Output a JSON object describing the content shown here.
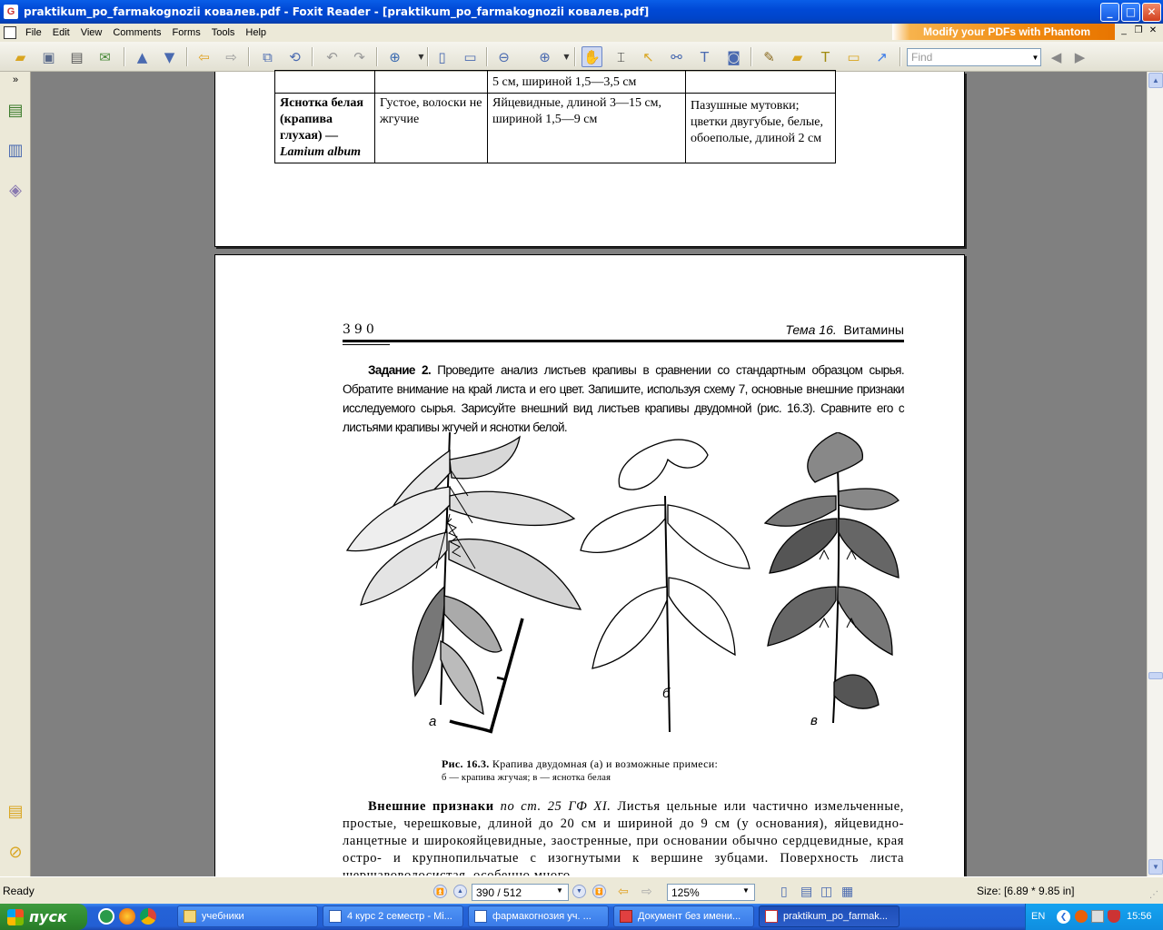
{
  "window": {
    "title": "praktikum_po_farmakognozii ковалев.pdf - Foxit Reader - [praktikum_po_farmakognozii ковалев.pdf]",
    "title_icon": "G",
    "minimize": "_",
    "maximize": "□",
    "close": "✕"
  },
  "menu": {
    "items": [
      "File",
      "Edit",
      "View",
      "Comments",
      "Forms",
      "Tools",
      "Help"
    ],
    "promo": "Modify your PDFs with Phantom",
    "mdi_min": "_",
    "mdi_restore": "❐",
    "mdi_close": "✕"
  },
  "toolbar": {
    "find_placeholder": "Find"
  },
  "page1": {
    "table_rows": [
      {
        "col1": "",
        "col2": "",
        "col3": "5 см, шириной 1,5—3,5 см",
        "col4": ""
      },
      {
        "col1a": "Яснотка белая (крапива глухая) —",
        "col1b": "Lamium album",
        "col2": "Густое, волоски не жгучие",
        "col3": "Яйцевидные, длиной 3—15 см, шириной 1,5—9 см",
        "col4": "Пазушные мутовки; цветки двугубые, белые, обоеполые, длиной 2 см"
      }
    ]
  },
  "page2": {
    "page_number": "390",
    "header_topic": "Тема 16.",
    "header_title": "Витамины",
    "task_label": "Задание 2.",
    "task_text": "Проведите анализ листьев крапивы в сравнении со стандартным образцом сырья. Обратите внимание на край листа и его цвет. Запишите, используя схему 7, основные внешние признаки исследуемого сырья. Зарисуйте внешний вид листьев крапивы двудомной (рис. 16.3). Сравните его с листьями крапивы жгучей и яснотки белой.",
    "fig_label_a": "а",
    "fig_label_b": "б",
    "fig_label_c": "в",
    "caption_bold": "Рис. 16.3.",
    "caption_line1": "Крапива двудомная (а) и возможные примеси:",
    "caption_line2": "б — крапива жгучая; в — яснотка белая",
    "body_bold": "Внешние признаки",
    "body_italic": "по ст. 25 ГФ XI.",
    "body_text": "Листья цельные или частично измельченные, простые, черешковые, длиной до 20 см и шириной до 9 см (у основания), яйцевидно-ланцетные и широкояйцевидные, заостренные, при основании обычно сердцевидные, края остро- и крупнопильчатые с изогнутыми к вершине зубцами. Поверхность листа шершавоволосистая, особенно много"
  },
  "status": {
    "ready": "Ready",
    "page_value": "390 / 512",
    "zoom_value": "125%",
    "size": "Size: [6.89 * 9.85 in]"
  },
  "taskbar": {
    "start": "пуск",
    "tasks": [
      "учебники",
      "4 курс 2 семестр - Mi...",
      "фармакогнозия уч. ...",
      "Документ без имени...",
      "praktikum_po_farmak..."
    ],
    "lang": "EN",
    "time": "15:56"
  },
  "colors": {
    "titlebar": "#0a5ee8",
    "promo": "#f08a10",
    "taskbar": "#2463d8",
    "start": "#2f8a2f"
  }
}
